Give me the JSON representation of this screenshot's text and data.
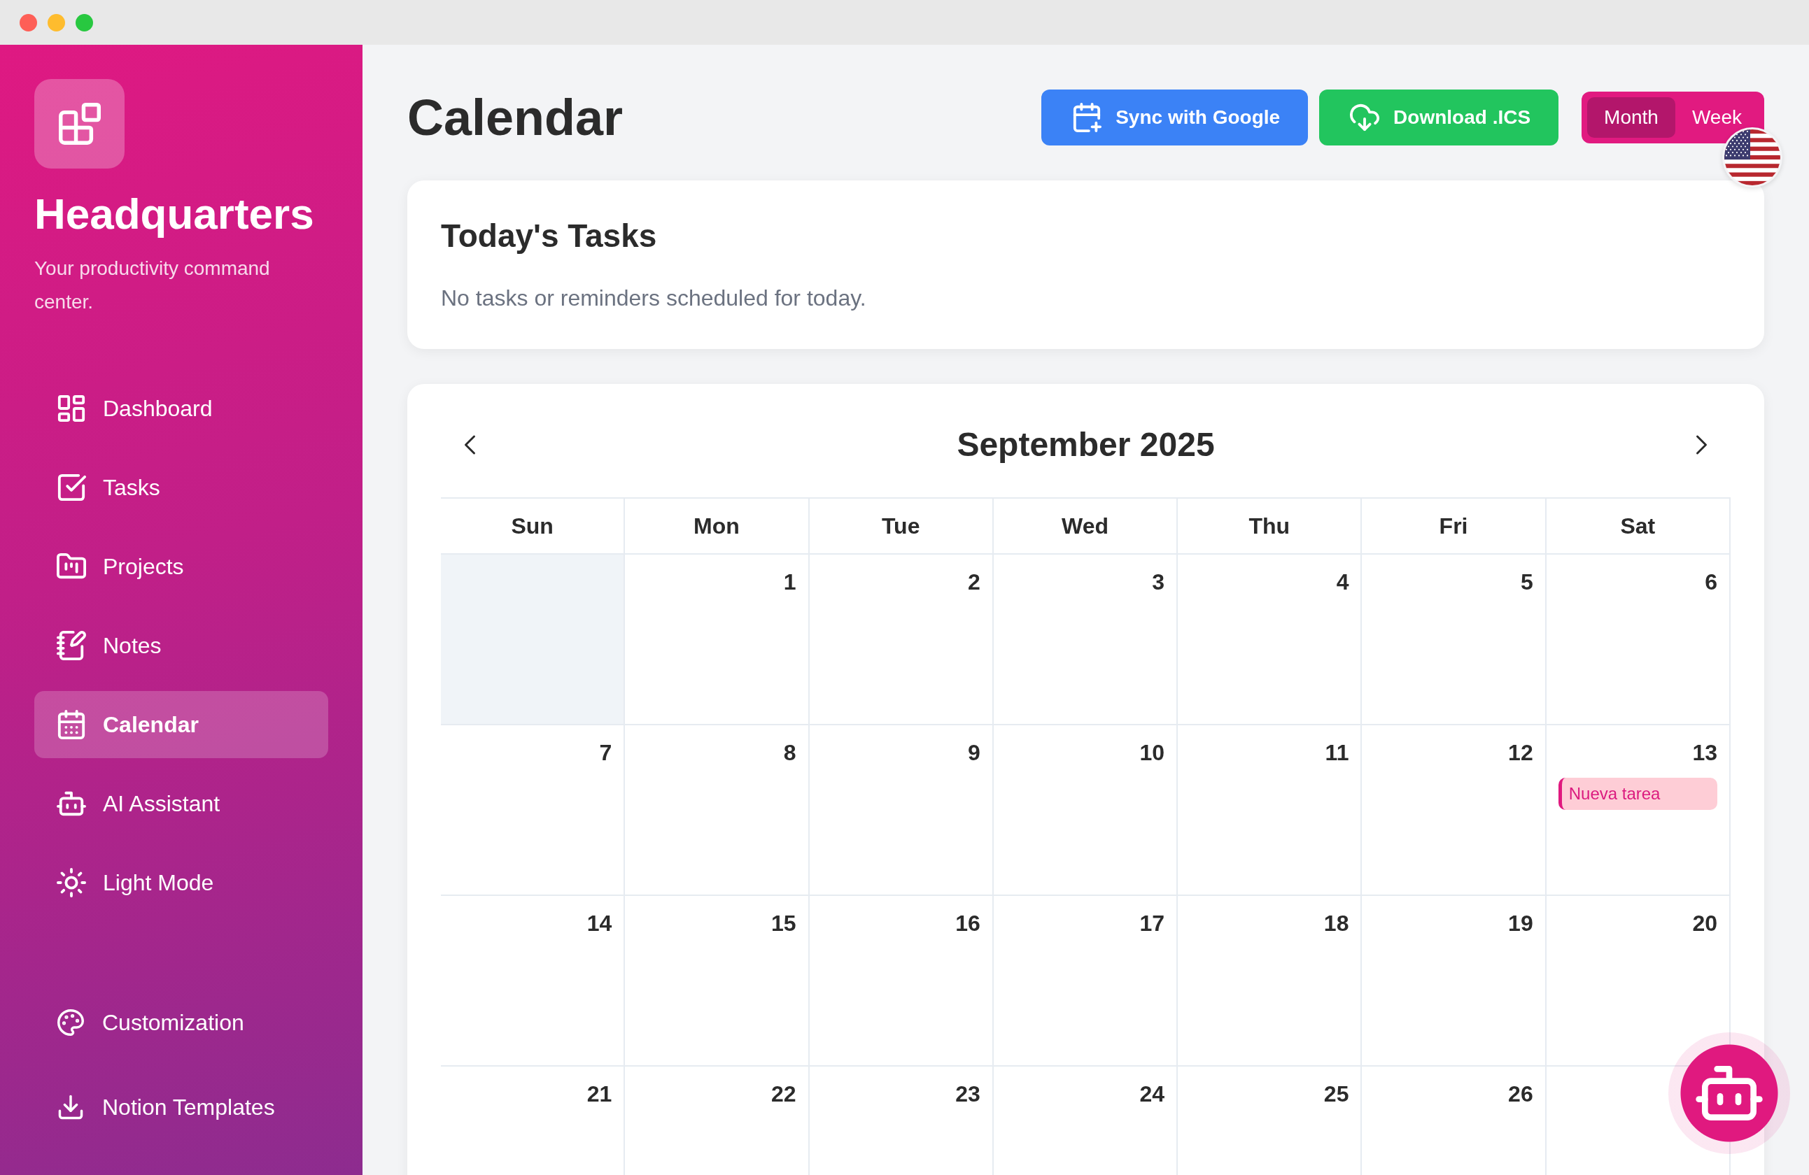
{
  "sidebar": {
    "app_name": "Headquarters",
    "tagline": "Your productivity command center.",
    "nav_items": [
      {
        "label": "Dashboard",
        "selected": false
      },
      {
        "label": "Tasks",
        "selected": false
      },
      {
        "label": "Projects",
        "selected": false
      },
      {
        "label": "Notes",
        "selected": false
      },
      {
        "label": "Calendar",
        "selected": true
      },
      {
        "label": "AI Assistant",
        "selected": false
      },
      {
        "label": "Light Mode",
        "selected": false
      }
    ],
    "footer_links": [
      {
        "label": "Customization"
      },
      {
        "label": "Notion Templates"
      }
    ]
  },
  "header": {
    "title": "Calendar",
    "actions": [
      {
        "kind": "sync",
        "label": "Sync with Google"
      },
      {
        "kind": "download",
        "label": "Download .ICS"
      }
    ],
    "view_toggle": [
      {
        "label": "Month",
        "selected": true
      },
      {
        "label": "Week",
        "selected": false
      }
    ]
  },
  "todays_tasks": {
    "title": "Today's Tasks",
    "message": "No tasks or reminders scheduled for today."
  },
  "calendar": {
    "month": "September 2025",
    "weekdays": [
      "Sun",
      "Mon",
      "Tue",
      "Wed",
      "Thu",
      "Fri",
      "Sat"
    ],
    "weeks": [
      [
        {
          "kind": "outside"
        },
        {
          "kind": "day",
          "date": "1"
        },
        {
          "kind": "day",
          "date": "2"
        },
        {
          "kind": "day",
          "date": "3"
        },
        {
          "kind": "day",
          "date": "4"
        },
        {
          "kind": "day",
          "date": "5"
        },
        {
          "kind": "day",
          "date": "6"
        }
      ],
      [
        {
          "kind": "day",
          "date": "7"
        },
        {
          "kind": "day",
          "date": "8"
        },
        {
          "kind": "day",
          "date": "9"
        },
        {
          "kind": "day",
          "date": "10"
        },
        {
          "kind": "day",
          "date": "11"
        },
        {
          "kind": "day",
          "date": "12"
        },
        {
          "kind": "day",
          "date": "13",
          "events": [
            {
              "title": "Nueva tarea"
            }
          ]
        }
      ],
      [
        {
          "kind": "day",
          "date": "14"
        },
        {
          "kind": "day",
          "date": "15"
        },
        {
          "kind": "day",
          "date": "16"
        },
        {
          "kind": "day",
          "date": "17"
        },
        {
          "kind": "day",
          "date": "18"
        },
        {
          "kind": "day",
          "date": "19"
        },
        {
          "kind": "day",
          "date": "20"
        }
      ],
      [
        {
          "kind": "day",
          "date": "21"
        },
        {
          "kind": "day",
          "date": "22"
        },
        {
          "kind": "day",
          "date": "23"
        },
        {
          "kind": "day",
          "date": "24"
        },
        {
          "kind": "day",
          "date": "25"
        },
        {
          "kind": "day",
          "date": "26"
        },
        {
          "kind": "day"
        }
      ]
    ]
  }
}
